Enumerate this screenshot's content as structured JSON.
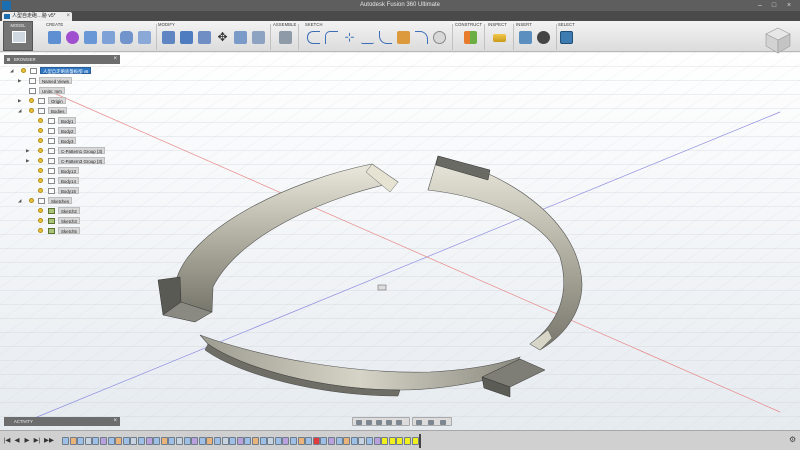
{
  "window": {
    "title": "Autodesk Fusion 360 Ultimate",
    "minimize": "–",
    "maximize": "□",
    "close": "×"
  },
  "tab": {
    "label": "人型自走砲…胁 v5*",
    "close": "×"
  },
  "toolbar": {
    "model": "MODEL",
    "create": "CREATE",
    "modify": "MODIFY",
    "assemble": "ASSEMBLE",
    "sketch": "SKETCH",
    "construct": "CONSTRUCT",
    "inspect": "INSPECT",
    "insert": "INSERT",
    "select": "SELECT"
  },
  "browser": {
    "title": "BROWSER",
    "close": "×",
    "items": [
      {
        "label": "人型自走砲底盤板卻 v5",
        "type": "root"
      },
      {
        "label": "Named Views",
        "type": "folder"
      },
      {
        "label": "Units: mm",
        "type": "units"
      },
      {
        "label": "Origin",
        "type": "folder"
      },
      {
        "label": "Bodies",
        "type": "folder"
      },
      {
        "label": "Body1",
        "type": "body"
      },
      {
        "label": "Body2",
        "type": "body"
      },
      {
        "label": "Body3",
        "type": "body"
      },
      {
        "label": "C-Pattern1 Group (3)",
        "type": "group"
      },
      {
        "label": "C-Pattern3 Group (3)",
        "type": "group"
      },
      {
        "label": "Body13",
        "type": "body"
      },
      {
        "label": "Body14",
        "type": "body"
      },
      {
        "label": "Body15",
        "type": "body"
      },
      {
        "label": "Sketches",
        "type": "folder"
      },
      {
        "label": "Sketch2",
        "type": "sketch"
      },
      {
        "label": "Sketch3",
        "type": "sketch"
      },
      {
        "label": "Sketch5",
        "type": "sketch"
      }
    ]
  },
  "activity": {
    "title": "ACTIVITY",
    "close": "×"
  },
  "timeline": {
    "first": "|◀",
    "prev": "◀",
    "play": "▶",
    "next": "▶|",
    "last": "▶▶"
  },
  "colors": {
    "accent": "#2f76c3",
    "body_steel": "#a8a79b",
    "timeline_highlight": "#f2ef1e"
  }
}
